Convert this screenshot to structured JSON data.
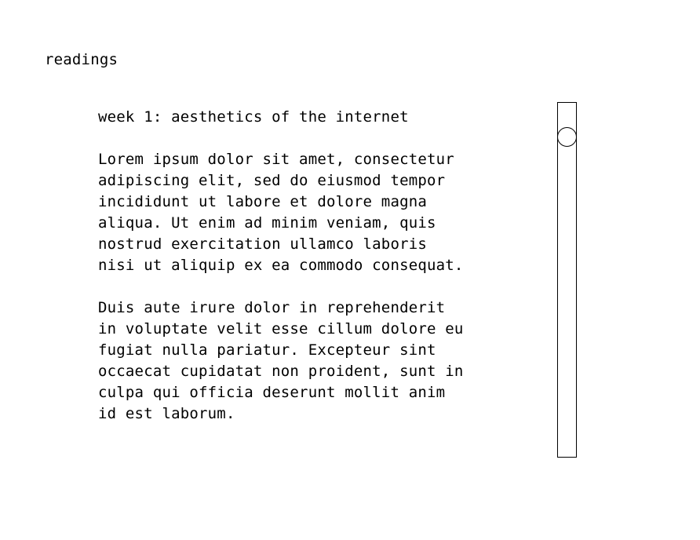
{
  "page": {
    "heading": "readings"
  },
  "reading": {
    "title": "week 1: aesthetics of the internet",
    "paragraphs": [
      {
        "lines": [
          "Lorem ipsum dolor sit amet, consectetur",
          "adipiscing elit, sed do eiusmod tempor",
          "incididunt ut labore et dolore magna",
          "aliqua. Ut enim ad minim veniam, quis",
          "nostrud exercitation ullamco laboris",
          "nisi ut aliquip ex ea commodo consequat."
        ]
      },
      {
        "lines": [
          "Duis aute irure dolor in reprehenderit",
          "in voluptate velit esse cillum dolore eu",
          "fugiat nulla pariatur. Excepteur sint",
          "occaecat cupidatat non proident, sunt in",
          "culpa qui officia deserunt mollit anim",
          "id est laborum."
        ]
      }
    ]
  },
  "scrollbar": {
    "scroll_position": 0.05,
    "colors": {
      "stroke": "#000000",
      "fill": "#ffffff"
    }
  }
}
